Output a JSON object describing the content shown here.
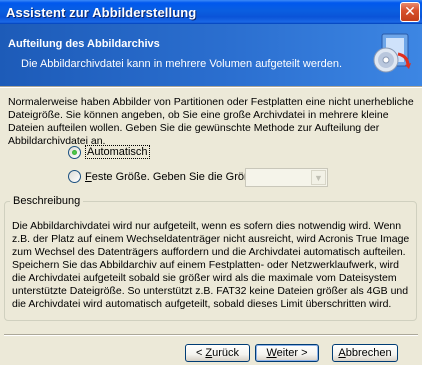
{
  "window": {
    "title": "Assistent zur Abbilderstellung",
    "close_glyph": "✕"
  },
  "header": {
    "title": "Aufteilung des Abbildarchivs",
    "subtitle": "Die Abbildarchivdatei kann in mehrere Volumen aufgeteilt werden.",
    "icon": "acronis-cd-backup-icon"
  },
  "intro_text": "Normalerweise haben Abbilder von Partitionen oder Festplatten eine nicht unerhebliche Dateigröße. Sie können angeben, ob Sie eine große Archivdatei in mehrere kleine Dateien aufteilen wollen. Geben Sie die gewünschte Methode zur Aufteilung der Abbildarchivdatei an.",
  "options": {
    "auto": {
      "label": "Automatisch",
      "checked": true
    },
    "fixed": {
      "label_hotkey": "F",
      "label_rest": "este Größe. Geben Sie die Größe an:",
      "checked": false
    }
  },
  "size_combo": {
    "value": "",
    "enabled": false
  },
  "description": {
    "legend": "Beschreibung",
    "text": "Die Abbildarchivdatei wird nur aufgeteilt, wenn es sofern dies notwendig wird. Wenn z.B. der Platz auf einem Wechseldatenträger nicht ausreicht, wird Acronis True Image zum Wechsel des Datenträgers auffordern und die Archivdatei automatisch aufteilen. Speichern Sie das Abbildarchiv auf einem Festplatten- oder Netzwerklaufwerk, wird die Archivdatei aufgeteilt sobald sie größer wird als die maximale vom Dateisystem unterstützte Dateigröße. So unterstützt z.B. FAT32 keine Dateien größer als 4GB und die Archivdatei wird automatisch aufgeteilt, sobald dieses Limit überschritten wird."
  },
  "buttons": {
    "back_prefix": "< ",
    "back_hotkey": "Z",
    "back_rest": "urück",
    "next_hotkey": "W",
    "next_rest": "eiter >",
    "cancel_hotkey": "A",
    "cancel_rest": "bbrechen"
  }
}
